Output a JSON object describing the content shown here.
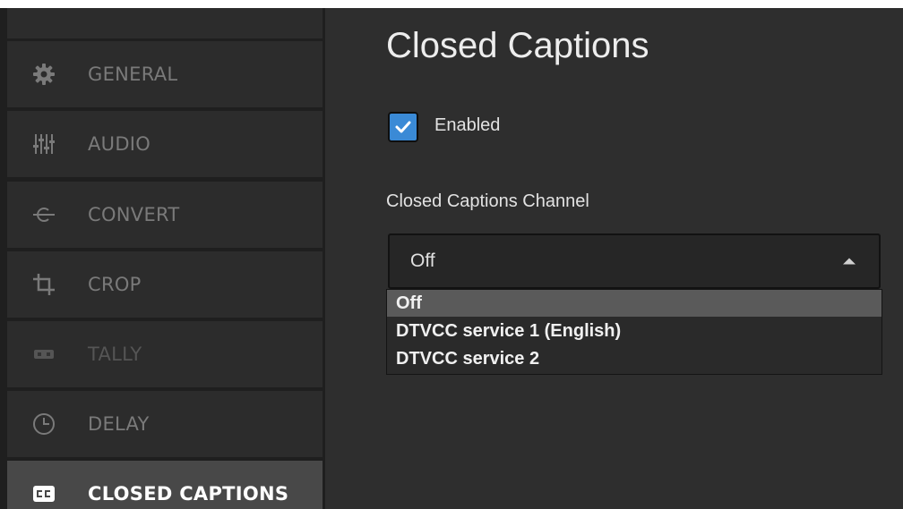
{
  "sidebar": {
    "items": [
      {
        "label": "GENERAL",
        "icon": "gear-icon"
      },
      {
        "label": "AUDIO",
        "icon": "sliders-icon"
      },
      {
        "label": "CONVERT",
        "icon": "convert-icon"
      },
      {
        "label": "CROP",
        "icon": "crop-icon"
      },
      {
        "label": "TALLY",
        "icon": "tally-icon"
      },
      {
        "label": "DELAY",
        "icon": "clock-icon"
      },
      {
        "label": "CLOSED CAPTIONS",
        "icon": "cc-icon"
      }
    ],
    "active_item": "CLOSED CAPTIONS"
  },
  "main": {
    "title": "Closed Captions",
    "enabled_checkbox": {
      "label": "Enabled",
      "checked": true
    },
    "channel": {
      "label": "Closed Captions Channel",
      "selected": "Off",
      "options": [
        "Off",
        "DTVCC service 1 (English)",
        "DTVCC service 2"
      ],
      "highlighted_option": "Off"
    }
  },
  "colors": {
    "checkbox_accent": "#3a8ad6",
    "panel_background": "#2e2e2e",
    "sidebar_item": "#2c2c2c",
    "sidebar_item_active": "#484848",
    "option_highlight": "#5a5a5a"
  }
}
